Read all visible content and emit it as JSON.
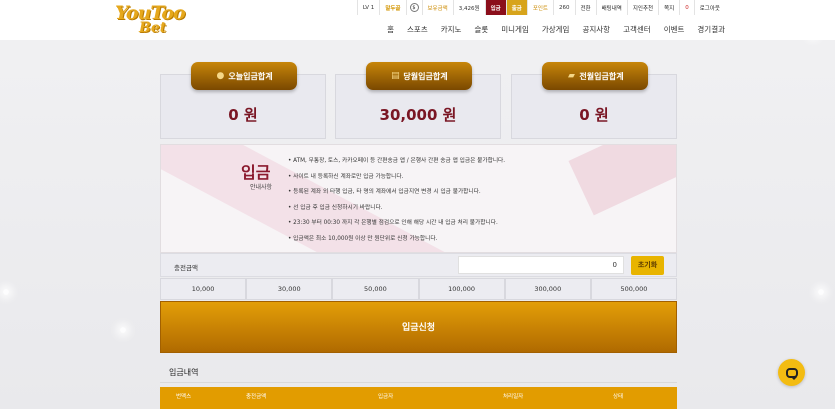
{
  "logo": {
    "line1": "YouToo",
    "line2": "Bet"
  },
  "userbar": {
    "level": "LV 1",
    "name": "말두골",
    "coin_icon": "coin-icon",
    "money_label": "보유금액",
    "money": "3,426원",
    "deposit_btn": "입금",
    "withdraw_btn": "출금",
    "point_label": "포인트",
    "points": "260",
    "convert": "전환",
    "bet_history": "배팅내역",
    "referral": "지인추천",
    "messages": "쪽지",
    "messages_count": "0",
    "logout": "로그아웃"
  },
  "nav": [
    "홈",
    "스포츠",
    "카지노",
    "슬롯",
    "미니게임",
    "가상게임",
    "공지사항",
    "고객센터",
    "이벤트",
    "경기결과"
  ],
  "cards": [
    {
      "label": "오늘입금합계",
      "amount": "0 원",
      "icon": "money-bag-icon"
    },
    {
      "label": "당월입금합계",
      "amount": "30,000 원",
      "icon": "cash-stack-icon"
    },
    {
      "label": "전월입금합계",
      "amount": "0 원",
      "icon": "gold-bars-icon"
    }
  ],
  "info": {
    "title": "입금",
    "subtitle": "안내사항",
    "notes": [
      "ATM, 무통장, 토스, 카카오페이 등 간편송금 앱 / 은행사 간편 송금 앱 입금은 불가합니다.",
      "사이트 내 등록하신 계좌로만 입금 가능합니다.",
      "등록된 계좌 외 타행 입금, 타 명의 계좌에서 입금지연 변경 시 입금 불가합니다.",
      "선 입금 후 입금 신청하시기 바랍니다.",
      "23:30 부터 00:30 까지 각 은행별 점검으로 인해 해당 시간 내 입금 처리 불가합니다.",
      "입금액은 최소 10,000원 이상 만 원단위로 신청 가능합니다."
    ]
  },
  "charge": {
    "label": "충전금액",
    "value": "0",
    "reset_label": "초기화"
  },
  "amount_buttons": [
    "10,000",
    "30,000",
    "50,000",
    "100,000",
    "300,000",
    "500,000"
  ],
  "apply_label": "입금신청",
  "history": {
    "title": "입금내역",
    "columns": [
      "번맥스",
      "충전금액",
      "입금자",
      "처리일자",
      "상태"
    ]
  },
  "colors": {
    "gold": "#e29c00",
    "burgundy": "#7a1624",
    "red_button": "#8b0e1b"
  }
}
